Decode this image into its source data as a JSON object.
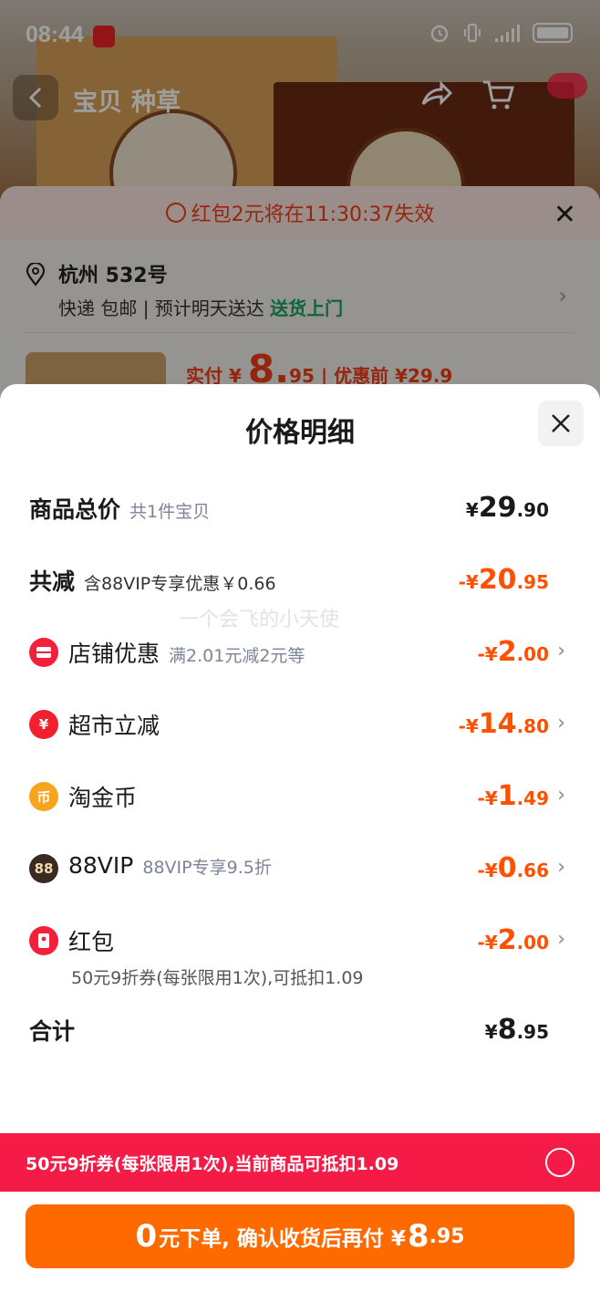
{
  "status_bar": {
    "time": "08:44"
  },
  "background": {
    "nav_tabs": [
      "宝贝",
      "种草"
    ],
    "timer_text": "红包2元将在11:30:37失效",
    "address_city": "杭州 532号",
    "shipping_plain": "快递 包邮 | 预计明天送达 ",
    "shipping_highlight": "送货上门",
    "price_prefix": "实付 ¥",
    "price_big": "8.",
    "price_small": "95",
    "price_before": " | 优惠前 ¥29.9"
  },
  "modal": {
    "title": "价格明细",
    "rows": [
      {
        "label": "商品总价",
        "sub": "共1件宝贝",
        "amount_yen": "¥",
        "amount_int": "29",
        "amount_dec": ".90"
      },
      {
        "label": "共减",
        "sub": "含88VIP专享优惠￥0.66",
        "amount_yen": "-¥",
        "amount_int": "20",
        "amount_dec": ".95"
      },
      {
        "label": "店铺优惠",
        "sub": "满2.01元减2元等",
        "amount_yen": "-¥",
        "amount_int": "2",
        "amount_dec": ".00"
      },
      {
        "label": "超市立减",
        "sub": "",
        "amount_yen": "-¥",
        "amount_int": "14",
        "amount_dec": ".80"
      },
      {
        "label": "淘金币",
        "sub": "",
        "amount_yen": "-¥",
        "amount_int": "1",
        "amount_dec": ".49"
      },
      {
        "label": "88VIP",
        "sub": "88VIP专享9.5折",
        "amount_yen": "-¥",
        "amount_int": "0",
        "amount_dec": ".66",
        "icon_text": "88"
      },
      {
        "label": "红包",
        "sub": "",
        "amount_yen": "-¥",
        "amount_int": "2",
        "amount_dec": ".00",
        "note": "50元9折券(每张限用1次),可抵扣1.09"
      },
      {
        "label": "合计",
        "sub": "",
        "amount_yen": "¥",
        "amount_int": "8",
        "amount_dec": ".95"
      }
    ],
    "watermark": "一个会飞的小天使"
  },
  "coupon_bar": {
    "text": "50元9折券(每张限用1次),当前商品可抵扣1.09"
  },
  "order_button": {
    "big": "0",
    "mid": "元下单, 确认收货后再付 ¥",
    "big2": "8",
    "small": ".95"
  },
  "colors": {
    "accent_orange": "#ff5000",
    "coupon_red": "#f41b46",
    "button_orange": "#ff6a00"
  },
  "icons": [
    "alarm-icon",
    "vibrate-icon",
    "signal-icon",
    "battery-icon",
    "back-icon",
    "share-icon",
    "cart-icon",
    "clock-icon",
    "close-icon",
    "location-icon",
    "chevron-right-icon",
    "shop-coupon-icon",
    "supermarket-yen-icon",
    "gold-coin-icon",
    "vip88-icon",
    "red-packet-icon",
    "radio-icon"
  ]
}
